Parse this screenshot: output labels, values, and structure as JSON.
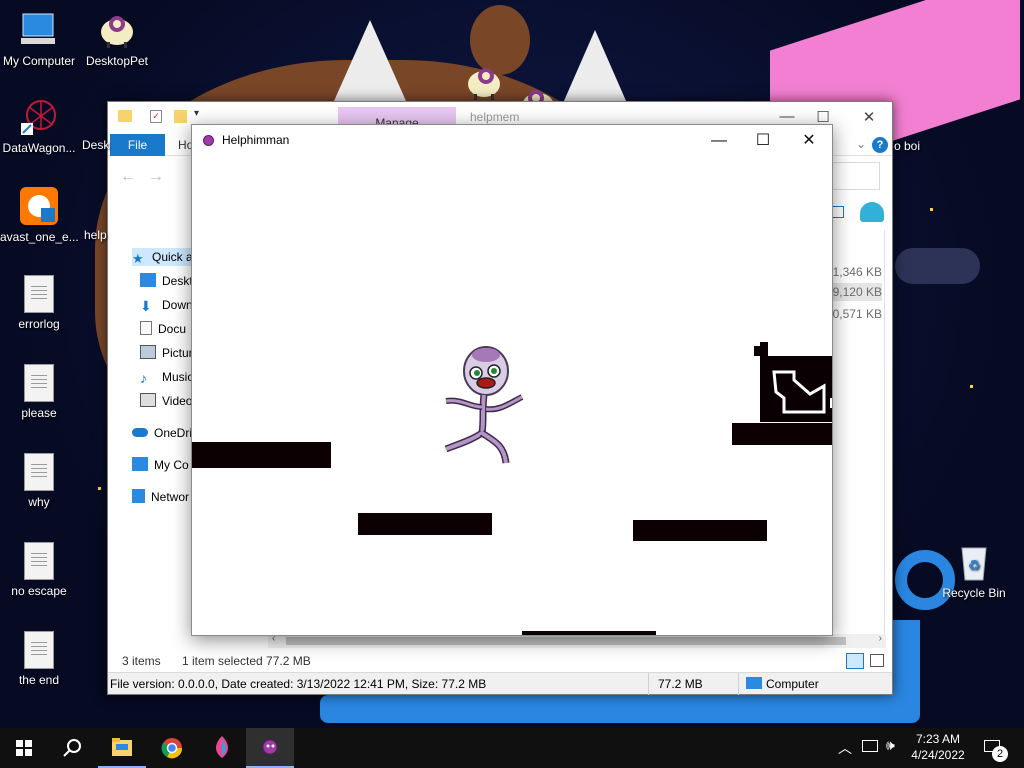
{
  "desktop": {
    "icons": [
      {
        "label": "My Computer"
      },
      {
        "label": "DesktopPet"
      },
      {
        "label": "DataWagon..."
      },
      {
        "label": "avast_one_e..."
      },
      {
        "label": "errorlog"
      },
      {
        "label": "please"
      },
      {
        "label": "why"
      },
      {
        "label": "no escape"
      },
      {
        "label": "the end"
      },
      {
        "label": "Recycle Bin"
      }
    ],
    "partial_labels": {
      "desk": "Desk",
      "help": "help",
      "boi": "o boi"
    }
  },
  "explorer": {
    "manage_tab": "Manage",
    "title_partial": "helpmem",
    "file_tab": "File",
    "home_tab": "Ho",
    "help_glyph": "?",
    "nav": [
      {
        "label": "Quick a"
      },
      {
        "label": "Deskto"
      },
      {
        "label": "Down"
      },
      {
        "label": "Docu"
      },
      {
        "label": "Pictur"
      },
      {
        "label": "Music"
      },
      {
        "label": "Video"
      },
      {
        "label": "OneDri"
      },
      {
        "label": "My Co"
      },
      {
        "label": "Networ"
      }
    ],
    "file_sizes": [
      "1,346 KB",
      "9,120 KB",
      "0,571 KB"
    ],
    "status": {
      "items": "3 items",
      "selected": "1 item selected  77.2 MB",
      "file_version": "File version: 0.0.0.0, Date created: 3/13/2022 12:41 PM, Size: 77.2 MB",
      "size": "77.2 MB",
      "location": "Computer"
    }
  },
  "game_window": {
    "title": "Helphimman",
    "minimize": "—",
    "maximize": "☐",
    "close": "✕"
  },
  "taskbar": {
    "time": "7:23 AM",
    "date": "4/24/2022",
    "notification_count": "2"
  }
}
